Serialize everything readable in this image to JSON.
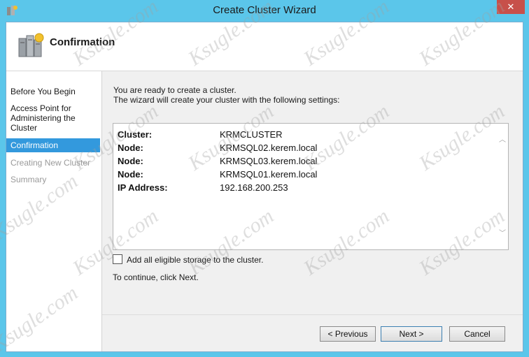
{
  "window": {
    "title": "Create Cluster Wizard",
    "close_glyph": "✕"
  },
  "header": {
    "title": "Confirmation"
  },
  "nav": {
    "items": [
      {
        "label": "Before You Begin",
        "state": "done"
      },
      {
        "label": "Access Point for Administering the Cluster",
        "state": "done"
      },
      {
        "label": "Confirmation",
        "state": "selected"
      },
      {
        "label": "Creating New Cluster",
        "state": "disabled"
      },
      {
        "label": "Summary",
        "state": "disabled"
      }
    ]
  },
  "content": {
    "intro_line1": "You are ready to create a cluster.",
    "intro_line2": "The wizard will create your cluster with the following settings:",
    "settings": [
      {
        "key": "Cluster:",
        "value": "KRMCLUSTER"
      },
      {
        "key": "Node:",
        "value": "KRMSQL02.kerem.local"
      },
      {
        "key": "Node:",
        "value": "KRMSQL03.kerem.local"
      },
      {
        "key": "Node:",
        "value": "KRMSQL01.kerem.local"
      },
      {
        "key": "IP Address:",
        "value": "192.168.200.253"
      }
    ],
    "add_storage_label": "Add all eligible storage to the cluster.",
    "add_storage_checked": false,
    "continue_text": "To continue, click Next."
  },
  "buttons": {
    "previous": "< Previous",
    "next": "Next >",
    "cancel": "Cancel"
  },
  "watermark": "Ksugle.com",
  "colors": {
    "frame": "#5bc6ea",
    "selected": "#3399dd",
    "close": "#c7504a"
  }
}
